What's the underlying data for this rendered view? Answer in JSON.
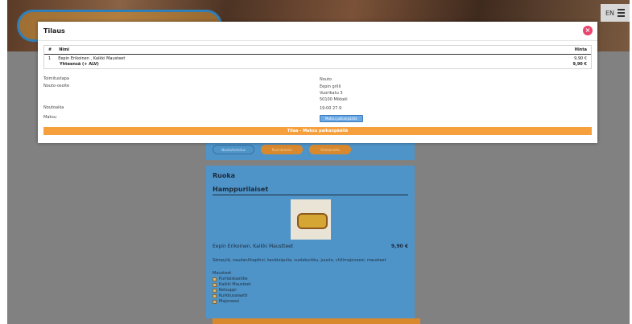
{
  "header": {
    "lang": "EN"
  },
  "background": {
    "tabs": [
      "Nouto/toimitus",
      "Ravintolasta",
      "Vastaanotto"
    ],
    "section_title": "Ruoka",
    "category_title": "Hamppurilaiset",
    "product_name": "Eepin Erikoinen, Kaikki Maustteet",
    "product_price": "9,90 €",
    "product_desc": "Sämpylä, naudanlihapihvi, kevätsipulia, suolakurkku, juusto, chilimajoneesi, mausteet",
    "sauce_label": "Mausteet",
    "sauces": [
      "Purilaiskastike",
      "Kaikki Mausteet",
      "Ketsuppi",
      "Kurkkusalaatti",
      "Majoneesi"
    ]
  },
  "modal": {
    "title": "Tilaus",
    "close_label": "×",
    "table": {
      "col_nr": "#",
      "col_name": "Nimi",
      "col_price": "Hinta",
      "rows": [
        {
          "nr": "1",
          "name": "Eepin Erikoinen , Kaikki Mausteet",
          "price": "9,90 €"
        }
      ],
      "total_label": "Yhteensä (+ ALV)",
      "total_value": "9,90 €"
    },
    "delivery_label": "Toimitustapa",
    "delivery_value": "Nouto",
    "address_label": "Nouto-osoite",
    "address_lines": [
      "Eepin grilli",
      "Vuorikatu 3",
      "50100 Mikkeli"
    ],
    "pickup_time_label": "Noutoaika",
    "pickup_time_value": "19:00 27.9",
    "payment_label": "Maksu",
    "payment_button": "Maksu paikanpäällä",
    "order_button": "Tilaa - Maksu paikanpäällä"
  }
}
